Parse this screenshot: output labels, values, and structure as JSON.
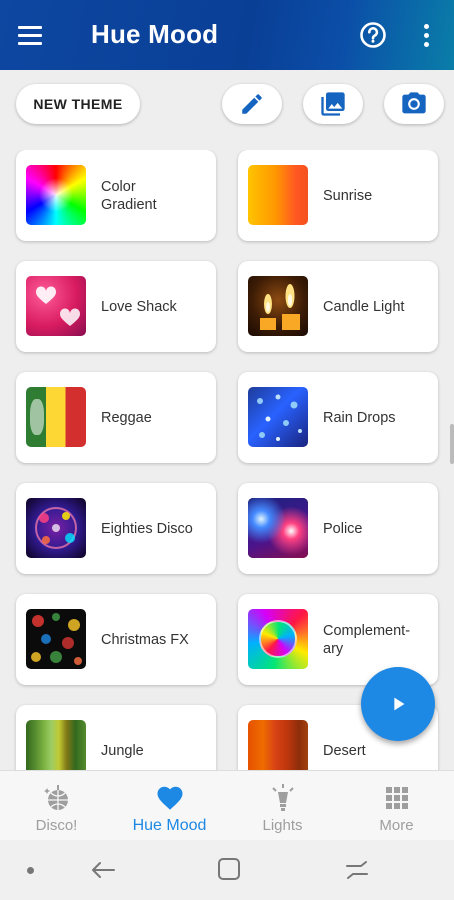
{
  "app_bar": {
    "title": "Hue Mood",
    "menu_icon": "hamburger-menu-icon",
    "help_icon": "help-circle-icon",
    "more_icon": "more-vertical-icon"
  },
  "toolbar": {
    "new_theme_label": "NEW THEME",
    "edit_icon": "pencil-icon",
    "image_icon": "image-icon",
    "camera_icon": "camera-icon",
    "icon_color": "#1565c0"
  },
  "themes": [
    {
      "name": "Color\nGradient"
    },
    {
      "name": "Sunrise"
    },
    {
      "name": "Love Shack"
    },
    {
      "name": "Candle Light"
    },
    {
      "name": "Reggae"
    },
    {
      "name": "Rain Drops"
    },
    {
      "name": "Eighties Disco"
    },
    {
      "name": "Police"
    },
    {
      "name": "Christmas FX"
    },
    {
      "name": "Complement-\nary"
    },
    {
      "name": "Jungle"
    },
    {
      "name": "Desert"
    }
  ],
  "fab": {
    "icon": "play-icon",
    "color": "#1e88e5"
  },
  "bottom_nav": [
    {
      "label": "Disco!",
      "icon": "disco-ball-icon"
    },
    {
      "label": "Hue Mood",
      "icon": "heart-icon",
      "active": true
    },
    {
      "label": "Lights",
      "icon": "light-bulb-icon"
    },
    {
      "label": "More",
      "icon": "grid-dots-icon"
    }
  ],
  "colors": {
    "accent": "#1e88e5",
    "app_bar": "#0d47a1"
  }
}
